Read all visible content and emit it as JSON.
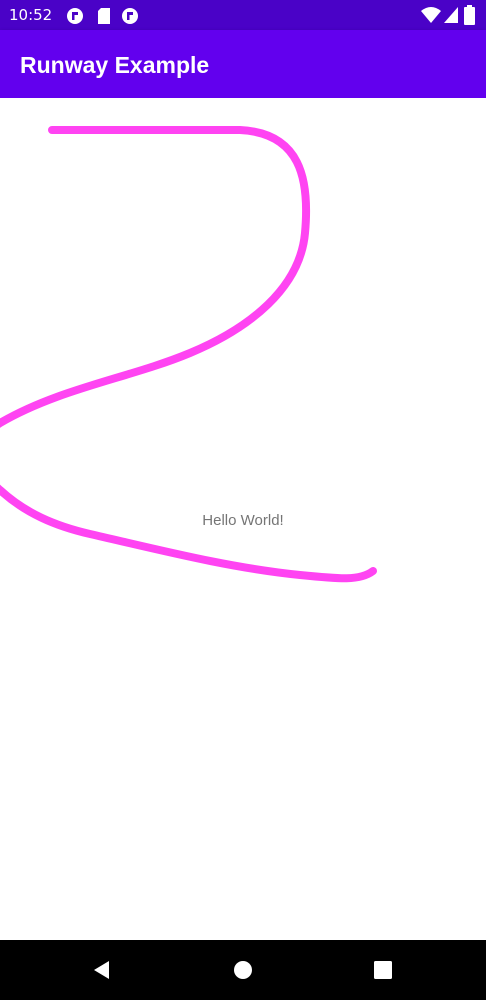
{
  "status_bar": {
    "time": "10:52",
    "left_icons": [
      "notification-circle-icon",
      "sd-card-icon",
      "notification-circle-icon"
    ],
    "right_icons": [
      "wifi-icon",
      "cell-signal-icon",
      "battery-icon"
    ]
  },
  "app_bar": {
    "title": "Runway Example",
    "color": "#6200ee"
  },
  "content": {
    "message": "Hello World!",
    "stroke_color": "#ff44f2"
  },
  "nav_bar": {
    "buttons": [
      "back-icon",
      "home-icon",
      "recents-icon"
    ]
  }
}
